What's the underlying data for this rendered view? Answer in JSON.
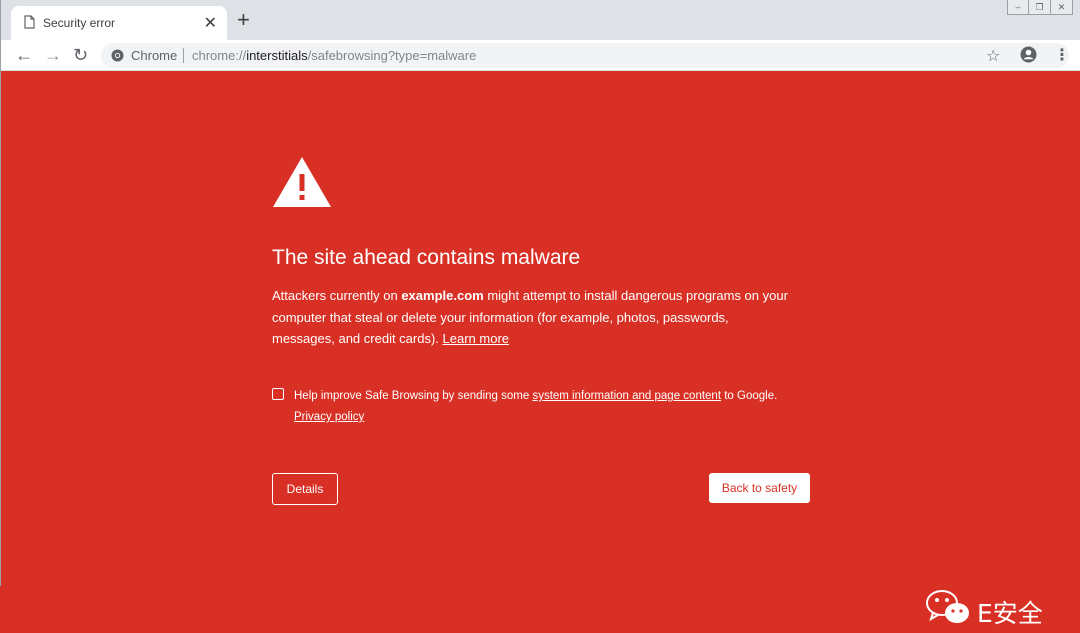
{
  "tab": {
    "title": "Security error",
    "close_glyph": "✕"
  },
  "new_tab_glyph": "+",
  "window_controls": {
    "minimize": "–",
    "restore": "❐",
    "close": "✕"
  },
  "toolbar": {
    "back_glyph": "←",
    "forward_glyph": "→",
    "reload_glyph": "↻",
    "site_label": "Chrome",
    "url_prefix": "chrome://",
    "url_host": "interstitials",
    "url_path": "/safebrowsing?type=malware",
    "star_glyph": "☆",
    "menu_glyph": "⋮"
  },
  "interstitial": {
    "heading": "The site ahead contains malware",
    "explain_before": "Attackers currently on ",
    "domain": "example.com",
    "explain_after": " might attempt to install dangerous programs on your computer that steal or delete your information (for example, photos, passwords, messages, and credit cards). ",
    "learn_more": "Learn more",
    "optin_before": "Help improve Safe Browsing by sending some ",
    "optin_link": "system information and page content",
    "optin_after": " to Google.",
    "privacy_policy": "Privacy policy",
    "optin_checked": false,
    "details_label": "Details",
    "back_label": "Back to safety"
  },
  "watermark": {
    "text": "E安全"
  },
  "colors": {
    "background": "#d93025",
    "tab_bar": "#dee1e6",
    "omnibox": "#f1f3f4"
  },
  "icons": [
    "page-icon",
    "close-icon",
    "plus-icon",
    "back-arrow-icon",
    "forward-arrow-icon",
    "reload-icon",
    "chrome-icon",
    "star-icon",
    "account-icon",
    "menu-icon",
    "warning-icon",
    "wechat-icon"
  ]
}
